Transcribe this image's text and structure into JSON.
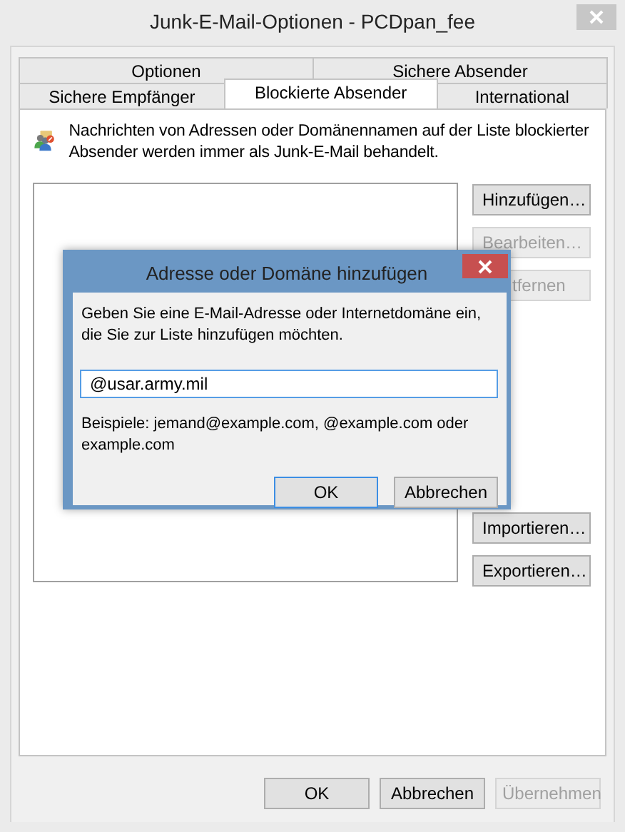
{
  "window": {
    "title": "Junk-E-Mail-Optionen - PCDpan_fee"
  },
  "tab_rows": [
    [
      {
        "label": "Optionen",
        "selected": false
      },
      {
        "label": "Sichere Absender",
        "selected": false
      }
    ],
    [
      {
        "label": "Sichere Empfänger",
        "selected": false
      },
      {
        "label": "Blockierte Absender",
        "selected": true
      },
      {
        "label": "International",
        "selected": false
      }
    ]
  ],
  "panel": {
    "description": "Nachrichten von Adressen oder Domänennamen auf der Liste blockierter Absender werden immer als Junk-E-Mail behandelt.",
    "side_buttons_upper": [
      {
        "label": "Hinzufügen…",
        "disabled": false
      },
      {
        "label": "Bearbeiten…",
        "disabled": true
      },
      {
        "label": "tfernen",
        "disabled": true
      }
    ],
    "side_buttons_lower": [
      {
        "label": "Importieren…",
        "disabled": false
      },
      {
        "label": "Exportieren…",
        "disabled": false
      }
    ]
  },
  "dialog": {
    "title": "Adresse oder Domäne hinzufügen",
    "prompt": "Geben Sie eine E-Mail-Adresse oder Internetdomäne ein, die Sie zur Liste hinzufügen möchten.",
    "value": "@usar.army.mil",
    "examples": "Beispiele: jemand@example.com, @example.com oder example.com",
    "buttons": [
      {
        "label": "OK",
        "default": true
      },
      {
        "label": "Abbrechen",
        "default": false
      }
    ]
  },
  "buttons": [
    {
      "label": "OK",
      "disabled": false
    },
    {
      "label": "Abbrechen",
      "disabled": false
    },
    {
      "label": "Übernehmen",
      "disabled": true
    }
  ]
}
